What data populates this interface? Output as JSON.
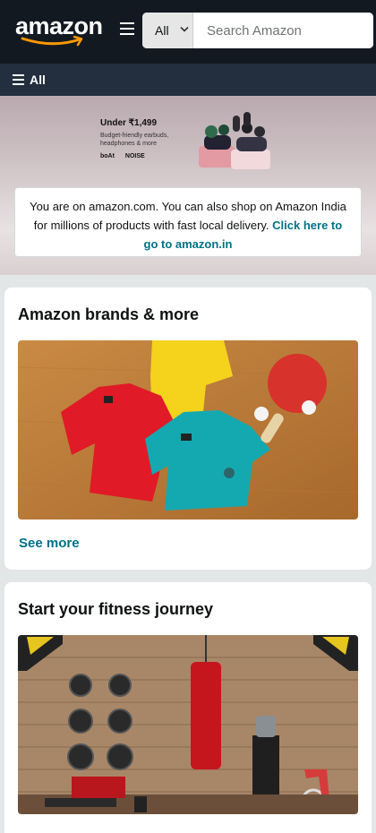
{
  "header": {
    "logo_text": "amazon",
    "search": {
      "category": "All",
      "placeholder": "Search Amazon"
    },
    "nav_all_label": "All"
  },
  "hero": {
    "promo_title": "Under ₹1,499",
    "promo_subtitle": "Budget-friendly earbuds, headphones & more",
    "promo_brands": [
      "boAt",
      "NOISE"
    ],
    "notice_text": "You are on amazon.com. You can also shop on Amazon India for millions of products with fast local delivery. ",
    "notice_link": "Click here to go to amazon.in"
  },
  "cards": [
    {
      "title": "Amazon brands & more",
      "link": "See more"
    },
    {
      "title": "Start your fitness journey"
    }
  ],
  "colors": {
    "header_bg": "#131921",
    "nav_bg": "#232f3e",
    "link": "#007185",
    "logo_smile": "#ff9900"
  }
}
